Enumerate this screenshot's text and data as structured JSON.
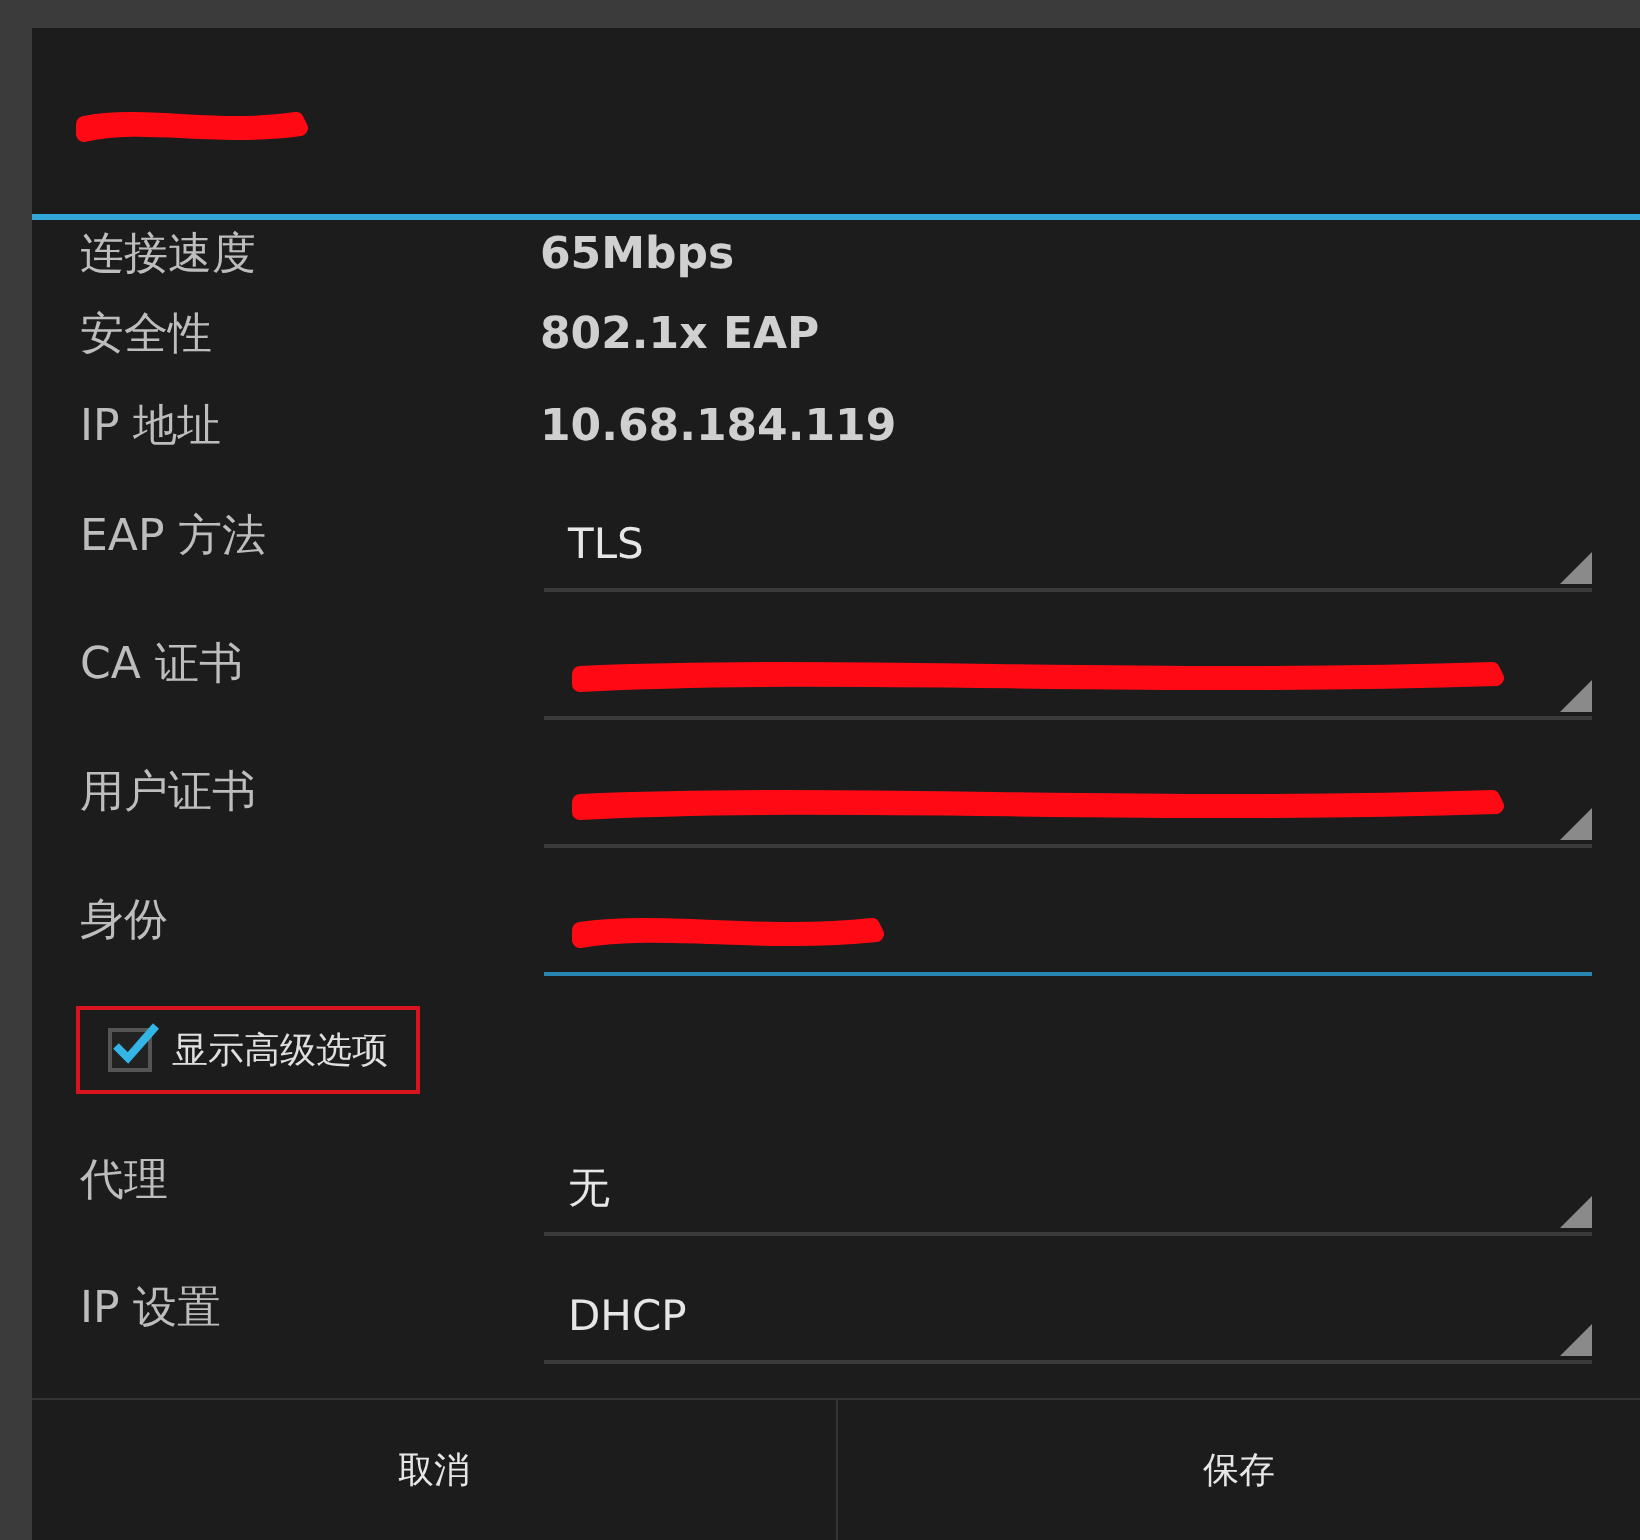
{
  "info_rows": [
    {
      "label": "连接速度",
      "value": "65Mbps"
    },
    {
      "label": "安全性",
      "value": "802.1x EAP"
    },
    {
      "label": "IP 地址",
      "value": "10.68.184.119"
    }
  ],
  "fields": [
    {
      "label": "EAP 方法",
      "kind": "spinner",
      "value": "TLS",
      "redacted": false
    },
    {
      "label": "CA 证书",
      "kind": "spinner",
      "redacted": true
    },
    {
      "label": "用户证书",
      "kind": "spinner",
      "redacted": true
    },
    {
      "label": "身份",
      "kind": "input",
      "redacted": true,
      "focused": true
    }
  ],
  "advanced": {
    "label": "显示高级选项",
    "checked": true,
    "annotated": true
  },
  "advanced_fields": [
    {
      "label": "代理",
      "kind": "spinner",
      "value": "无",
      "redacted": false
    },
    {
      "label": "IP 设置",
      "kind": "spinner",
      "value": "DHCP",
      "redacted": false
    }
  ],
  "buttons": [
    {
      "label": "取消"
    },
    {
      "label": "保存"
    }
  ]
}
